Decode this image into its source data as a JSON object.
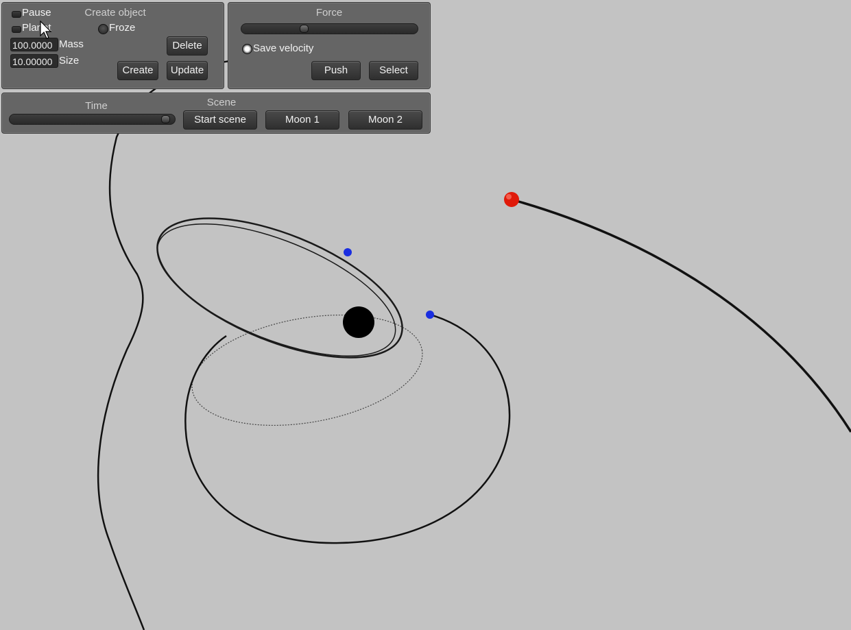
{
  "create_panel": {
    "title": "Create object",
    "pause_label": "Pause",
    "planet_label": "Planet",
    "froze_label": "Froze",
    "mass_value": "100.0000",
    "mass_label": "Mass",
    "size_value": "10.00000",
    "size_label": "Size",
    "delete_label": "Delete",
    "create_label": "Create",
    "update_label": "Update"
  },
  "force_panel": {
    "title": "Force",
    "force_level": 0.35,
    "save_velocity_label": "Save velocity",
    "push_label": "Push",
    "select_label": "Select"
  },
  "time_panel": {
    "title": "Time",
    "time_level": 0.97
  },
  "scene_panel": {
    "title": "Scene",
    "start_scene_label": "Start scene",
    "moon1_label": "Moon 1",
    "moon2_label": "Moon 2"
  },
  "bodies": {
    "central": {
      "color": "#000000"
    },
    "moon_a": {
      "color": "#1a2ee0"
    },
    "moon_b": {
      "color": "#1a2ee0"
    },
    "red_body": {
      "color": "#e01a0a"
    }
  }
}
